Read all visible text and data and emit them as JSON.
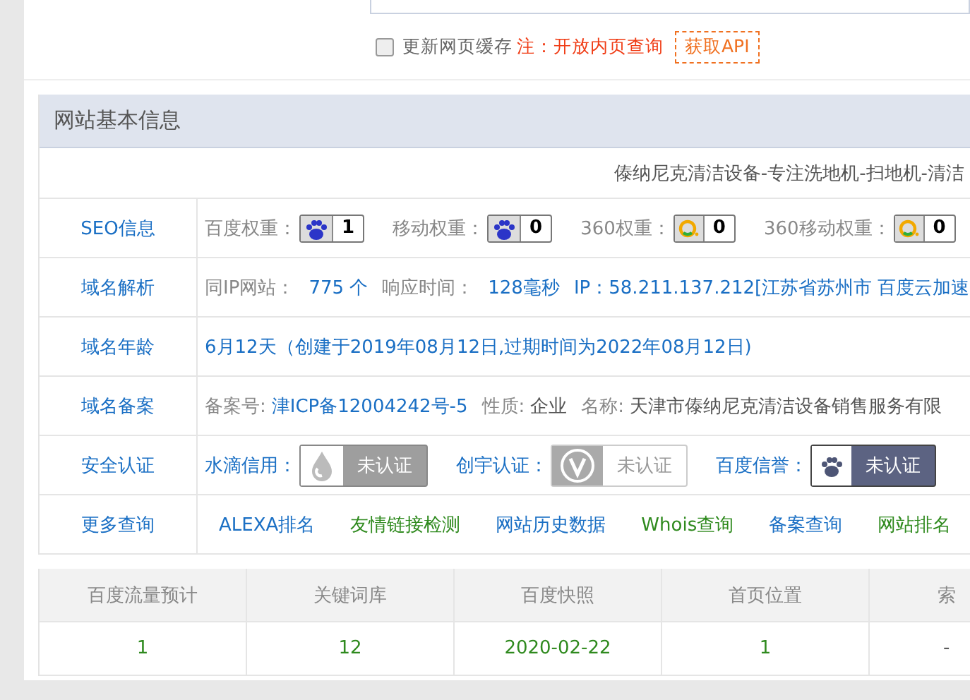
{
  "cache_option": {
    "label": "更新网页缓存",
    "checked": false,
    "note": "注：开放内页查询",
    "api_button": "获取API"
  },
  "panel": {
    "title": "网站基本信息",
    "site_title": "傣纳尼克清洁设备-专注洗地机-扫地机-清洁",
    "seo": {
      "label": "SEO信息",
      "weights": [
        {
          "label": "百度权重：",
          "kind": "paw",
          "value": "1"
        },
        {
          "label": "移动权重：",
          "kind": "paw",
          "value": "0"
        },
        {
          "label": "360权重：",
          "kind": "ring",
          "value": "0"
        },
        {
          "label": "360移动权重：",
          "kind": "ring",
          "value": "0"
        }
      ]
    },
    "dns": {
      "label": "域名解析",
      "same_ip_label": "同IP网站：",
      "same_ip_value": "775 个",
      "response_label": "响应时间：",
      "response_value": "128毫秒",
      "ip": "IP：58.211.137.212[江苏省苏州市 百度云加速"
    },
    "age": {
      "label": "域名年龄",
      "value": "6月12天（创建于2019年08月12日,过期时间为2022年08月12日)"
    },
    "icp": {
      "label": "域名备案",
      "number_label": "备案号:",
      "number": "津ICP备12004242号-5",
      "type_label": "性质:",
      "type": "企业",
      "name_label": "名称:",
      "name": "天津市傣纳尼克清洁设备销售服务有限"
    },
    "security": {
      "label": "安全认证",
      "certs": [
        {
          "label": "水滴信用：",
          "kind": "drop",
          "status": "未认证"
        },
        {
          "label": "创宇认证：",
          "kind": "v",
          "status": "未认证"
        },
        {
          "label": "百度信誉：",
          "kind": "paw",
          "status": "未认证"
        }
      ]
    },
    "more": {
      "label": "更多查询",
      "links": [
        {
          "text": "ALEXA排名",
          "color": "#1a6fc4"
        },
        {
          "text": "友情链接检测",
          "color": "#2f8a1e"
        },
        {
          "text": "网站历史数据",
          "color": "#1a6fc4"
        },
        {
          "text": "Whois查询",
          "color": "#2f8a1e"
        },
        {
          "text": "备案查询",
          "color": "#1a6fc4"
        },
        {
          "text": "网站排名",
          "color": "#2f8a1e"
        }
      ]
    }
  },
  "stats": {
    "columns": [
      "百度流量预计",
      "关键词库",
      "百度快照",
      "首页位置",
      "索"
    ],
    "row": [
      "1",
      "12",
      "2020-02-22",
      "1",
      "-"
    ]
  }
}
